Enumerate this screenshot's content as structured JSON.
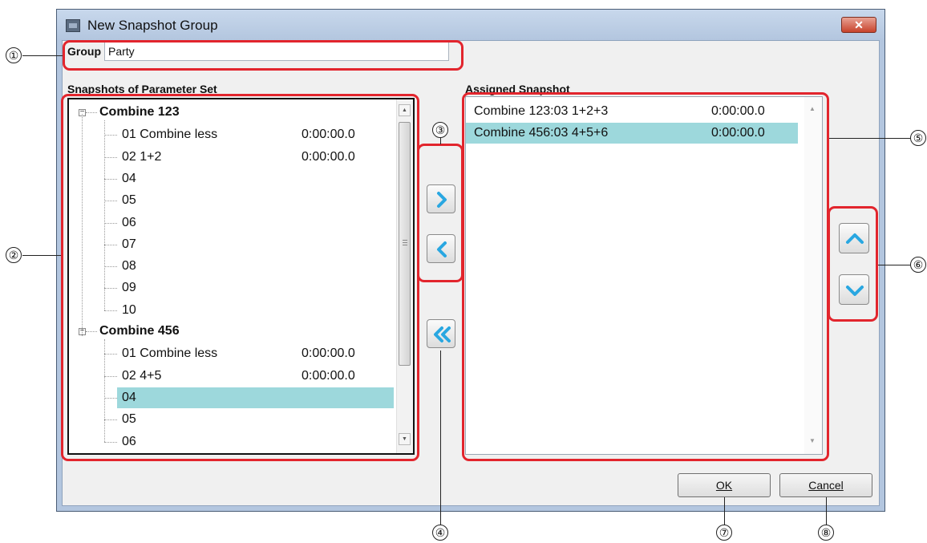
{
  "window": {
    "title": "New Snapshot Group",
    "close_glyph": "✕"
  },
  "group_name": {
    "label": "Group Name:",
    "value": "Party"
  },
  "snapshots_panel": {
    "label": "Snapshots of Parameter Set",
    "groups": [
      {
        "name": "Combine 123",
        "items": [
          {
            "label": "01 Combine less",
            "time": "0:00:00.0"
          },
          {
            "label": "02 1+2",
            "time": "0:00:00.0"
          },
          {
            "label": "04",
            "time": ""
          },
          {
            "label": "05",
            "time": ""
          },
          {
            "label": "06",
            "time": ""
          },
          {
            "label": "07",
            "time": ""
          },
          {
            "label": "08",
            "time": ""
          },
          {
            "label": "09",
            "time": ""
          },
          {
            "label": "10",
            "time": ""
          }
        ]
      },
      {
        "name": "Combine 456",
        "items": [
          {
            "label": "01 Combine less",
            "time": "0:00:00.0"
          },
          {
            "label": "02 4+5",
            "time": "0:00:00.0"
          },
          {
            "label": "04",
            "time": "",
            "selected": true
          },
          {
            "label": "05",
            "time": ""
          },
          {
            "label": "06",
            "time": ""
          }
        ]
      }
    ]
  },
  "assigned_panel": {
    "label": "Assigned Snapshot",
    "rows": [
      {
        "name": "Combine 123:03 1+2+3",
        "time": "0:00:00.0",
        "selected": false
      },
      {
        "name": "Combine 456:03 4+5+6",
        "time": "0:00:00.0",
        "selected": true
      }
    ]
  },
  "buttons": {
    "ok_label": "OK",
    "cancel_label": "Cancel",
    "add_icon": "chevron-right-icon",
    "remove_icon": "chevron-left-icon",
    "remove_all_icon": "double-chevron-left-icon",
    "move_up_icon": "chevron-up-icon",
    "move_down_icon": "chevron-down-icon"
  },
  "callouts": [
    "①",
    "②",
    "③",
    "④",
    "⑤",
    "⑥",
    "⑦",
    "⑧"
  ],
  "colors": {
    "selection": "#9dd8dc",
    "callout_border": "#e2252d",
    "arrow_icon": "#29a7e1",
    "title_bar": "#b3c6df",
    "close_button": "#c8432c"
  }
}
